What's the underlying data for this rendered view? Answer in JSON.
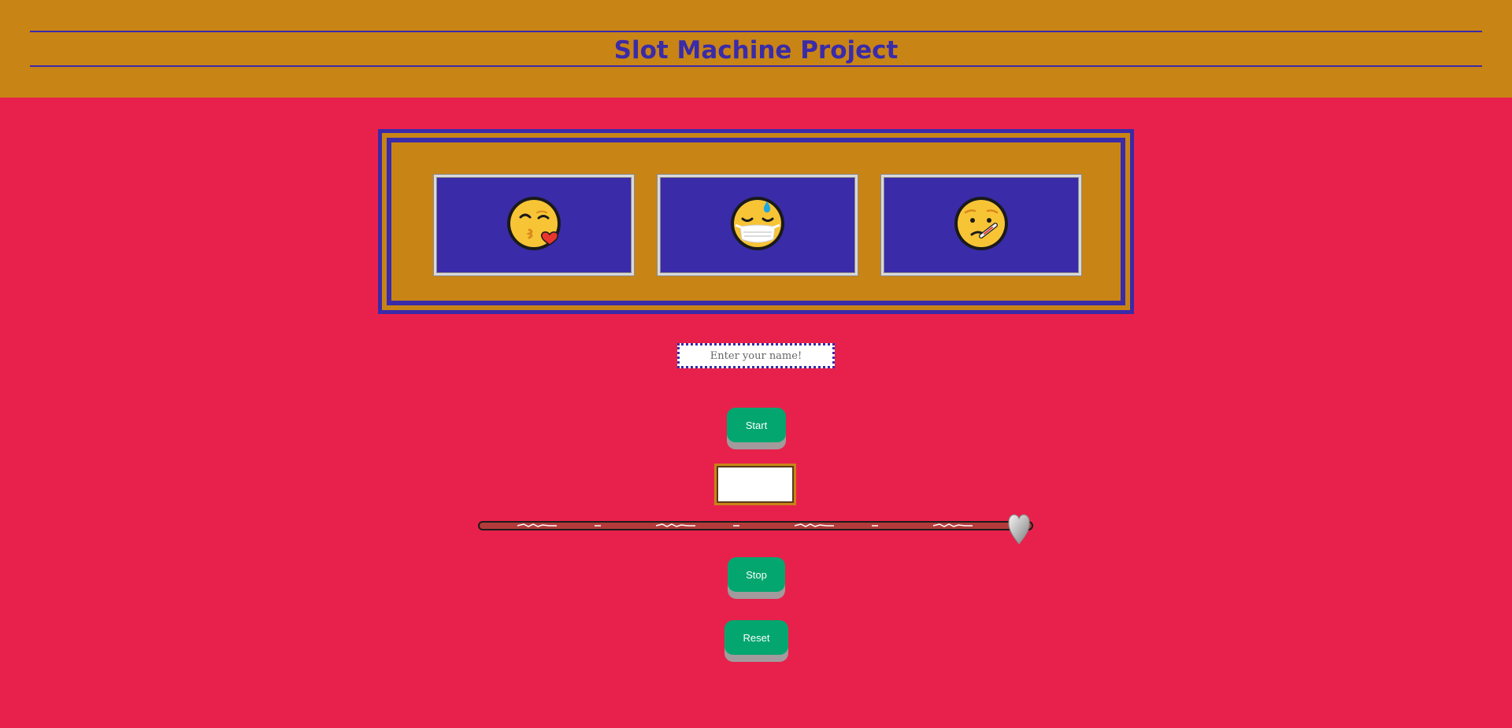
{
  "header": {
    "title": "Slot Machine Project"
  },
  "reels": [
    {
      "icon": "face-blowing-kiss-icon"
    },
    {
      "icon": "face-with-mask-sweat-icon"
    },
    {
      "icon": "face-with-thermometer-icon"
    }
  ],
  "name_input": {
    "placeholder": "Enter your name!",
    "value": ""
  },
  "buttons": {
    "start_label": "Start",
    "stop_label": "Stop",
    "reset_label": "Reset"
  },
  "result": {
    "value": ""
  },
  "slider": {
    "value_fraction": 1.0,
    "handle_icon": "silver-heart-icon"
  },
  "colors": {
    "background": "#e8214c",
    "header": "#c98416",
    "accent": "#3a2ba8",
    "button": "#03a66e"
  }
}
